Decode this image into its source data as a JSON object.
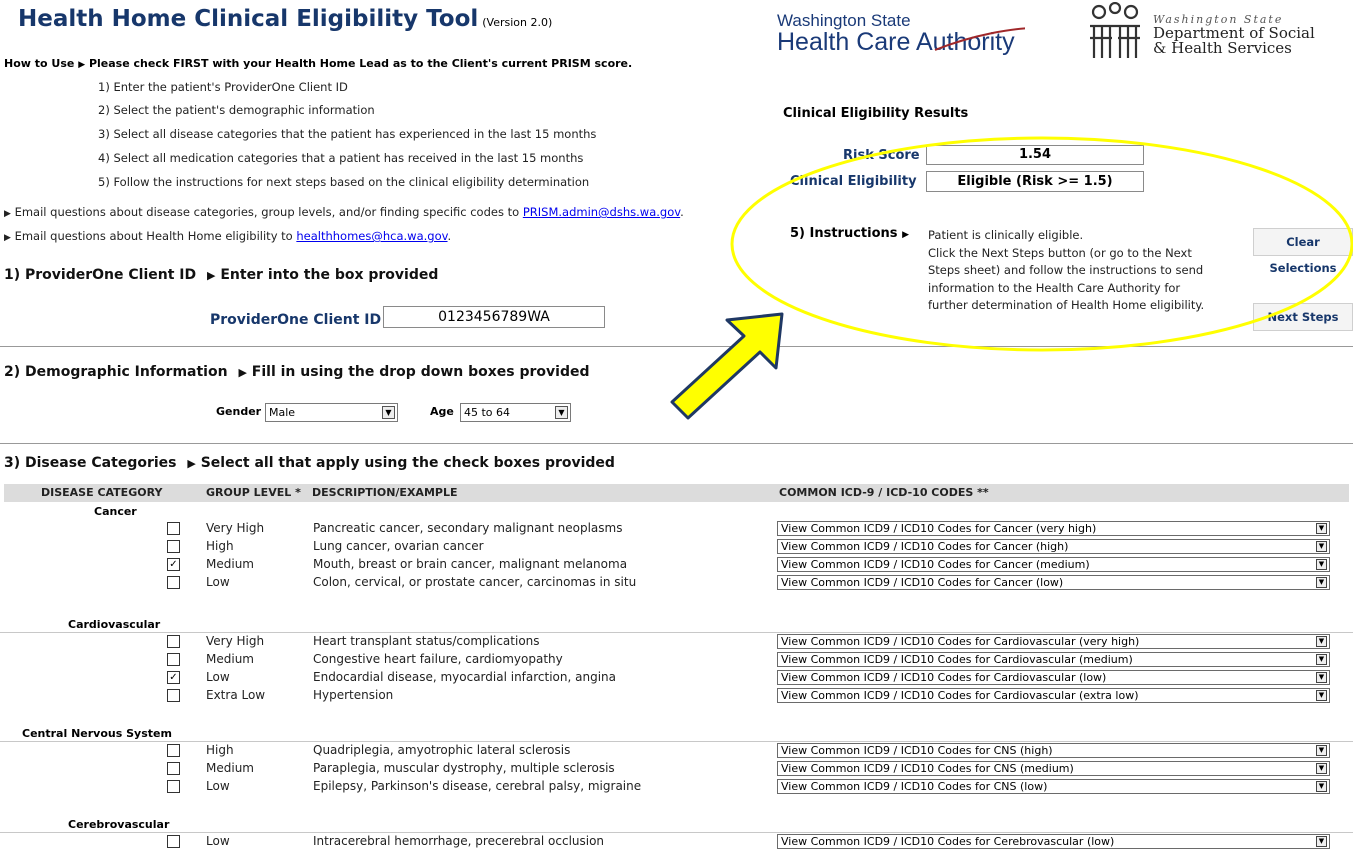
{
  "title": "Health Home Clinical Eligibility Tool",
  "version": "(Version 2.0)",
  "how_to_use": {
    "label": "How to Use",
    "text": "Please check FIRST with your Health Home Lead as to the Client's current PRISM score.",
    "steps": [
      "1) Enter the patient's ProviderOne Client ID",
      "2) Select the patient's demographic information",
      "3) Select all disease categories that the patient has experienced in the last 15 months",
      "4) Select all medication categories that a patient has received in the last 15 months",
      "5) Follow the instructions for next steps based on the clinical eligibility determination"
    ]
  },
  "emails": [
    {
      "text": "Email questions about disease categories, group levels, and/or finding specific codes  to ",
      "link": "PRISM.admin@dshs.wa.gov",
      "suffix": "."
    },
    {
      "text": "Email questions about Health Home eligibility to ",
      "link": "healthhomes@hca.wa.gov",
      "suffix": "."
    }
  ],
  "logos": {
    "hca_line1": "Washington State",
    "hca_line2": "Health Care Authority",
    "dshs_line1": "Washington State",
    "dshs_line2": "Department of Social",
    "dshs_line3": "& Health Services"
  },
  "section1": {
    "title": "1) ProviderOne Client ID",
    "hint": "Enter into the box provided",
    "field_label": "ProviderOne Client ID",
    "field_value": "0123456789WA"
  },
  "section2": {
    "title": "2) Demographic Information",
    "hint": "Fill in using the drop down boxes provided",
    "gender_label": "Gender",
    "gender_value": "Male",
    "age_label": "Age",
    "age_value": "45 to 64"
  },
  "results": {
    "title": "Clinical Eligibility Results",
    "risk_label": "Risk Score",
    "risk_value": "1.54",
    "elig_label": "Clinical Eligibility",
    "elig_value": "Eligible (Risk >= 1.5)",
    "instructions_label": "5) Instructions",
    "instructions_lines": [
      "Patient is clinically eligible.",
      "Click the Next Steps button (or go to the Next",
      "Steps sheet) and follow the instructions to send",
      "information to the Health Care Authority for",
      "further determination of Health Home eligibility."
    ],
    "clear_button": "Clear Selections",
    "next_button": "Next Steps"
  },
  "section3": {
    "title": "3) Disease Categories",
    "hint": "Select all that apply using the check boxes provided",
    "col_category": "DISEASE CATEGORY",
    "col_group": "GROUP LEVEL *",
    "col_desc": "DESCRIPTION/EXAMPLE",
    "col_codes": "COMMON ICD-9 / ICD-10 CODES **",
    "categories": [
      {
        "name": "Cancer",
        "rows": [
          {
            "level": "Very High",
            "desc": "Pancreatic cancer, secondary malignant neoplasms",
            "code": "View Common ICD9 / ICD10 Codes for Cancer (very high)",
            "checked": false
          },
          {
            "level": "High",
            "desc": "Lung cancer, ovarian cancer",
            "code": "View Common ICD9 / ICD10 Codes for Cancer (high)",
            "checked": false
          },
          {
            "level": "Medium",
            "desc": "Mouth, breast or brain cancer, malignant melanoma",
            "code": "View Common ICD9 / ICD10 Codes for Cancer (medium)",
            "checked": true
          },
          {
            "level": "Low",
            "desc": "Colon, cervical, or prostate cancer, carcinomas in situ",
            "code": "View Common ICD9 / ICD10 Codes for Cancer (low)",
            "checked": false
          }
        ]
      },
      {
        "name": "Cardiovascular",
        "rows": [
          {
            "level": "Very High",
            "desc": "Heart transplant status/complications",
            "code": "View Common ICD9 / ICD10 Codes for Cardiovascular (very high)",
            "checked": false
          },
          {
            "level": "Medium",
            "desc": "Congestive heart failure, cardiomyopathy",
            "code": "View Common ICD9 / ICD10 Codes for Cardiovascular (medium)",
            "checked": false
          },
          {
            "level": "Low",
            "desc": "Endocardial disease, myocardial infarction, angina",
            "code": "View Common ICD9 / ICD10 Codes for Cardiovascular (low)",
            "checked": true
          },
          {
            "level": "Extra Low",
            "desc": "Hypertension",
            "code": "View Common ICD9 / ICD10 Codes for Cardiovascular (extra low)",
            "checked": false
          }
        ]
      },
      {
        "name": "Central Nervous System",
        "rows": [
          {
            "level": "High",
            "desc": "Quadriplegia, amyotrophic lateral sclerosis",
            "code": "View Common ICD9 / ICD10 Codes for CNS (high)",
            "checked": false
          },
          {
            "level": "Medium",
            "desc": "Paraplegia, muscular dystrophy, multiple sclerosis",
            "code": "View Common ICD9 / ICD10 Codes for CNS (medium)",
            "checked": false
          },
          {
            "level": "Low",
            "desc": "Epilepsy, Parkinson's disease, cerebral palsy, migraine",
            "code": "View Common ICD9 / ICD10 Codes for CNS (low)",
            "checked": false
          }
        ]
      },
      {
        "name": "Cerebrovascular",
        "rows": [
          {
            "level": "Low",
            "desc": "Intracerebral hemorrhage, precerebral occlusion",
            "code": "View Common ICD9 / ICD10 Codes for Cerebrovascular (low)",
            "checked": false
          }
        ]
      }
    ]
  },
  "colors": {
    "title": "#17376b",
    "highlight": "#ffff00",
    "arrow": "#ffff00",
    "arrow_outline": "#1f3864"
  }
}
